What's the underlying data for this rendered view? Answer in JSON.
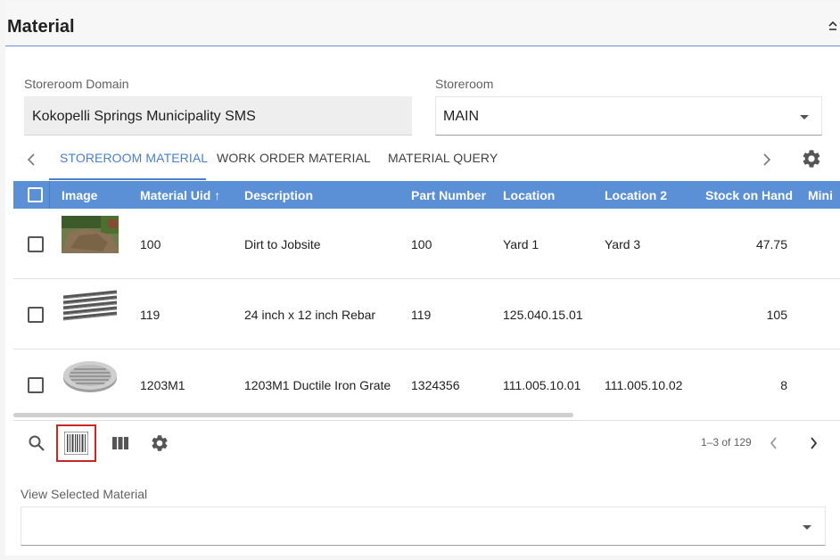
{
  "panel": {
    "title": "Material"
  },
  "form": {
    "domain_label": "Storeroom Domain",
    "domain_value": "Kokopelli Springs Municipality SMS",
    "storeroom_label": "Storeroom",
    "storeroom_value": "MAIN"
  },
  "tabs": {
    "items": [
      {
        "label": "STOREROOM MATERIAL",
        "active": true
      },
      {
        "label": "WORK ORDER MATERIAL",
        "active": false
      },
      {
        "label": "MATERIAL QUERY",
        "active": false
      }
    ]
  },
  "table": {
    "columns": {
      "image": "Image",
      "material_uid": "Material Uid",
      "description": "Description",
      "part_number": "Part Number",
      "location": "Location",
      "location2": "Location 2",
      "stock": "Stock on Hand",
      "min": "Mini"
    },
    "sort_indicator": "↑",
    "rows": [
      {
        "uid": "100",
        "description": "Dirt to Jobsite",
        "part_number": "100",
        "location": "Yard 1",
        "location2": "Yard 3",
        "stock": "47.75",
        "image": "dirt-photo"
      },
      {
        "uid": "119",
        "description": "24 inch x 12 inch Rebar",
        "part_number": "119",
        "location": "125.040.15.01",
        "location2": "",
        "stock": "105",
        "image": "rebar-photo"
      },
      {
        "uid": "1203M1",
        "description": "1203M1 Ductile Iron Grate",
        "part_number": "1324356",
        "location": "111.005.10.01",
        "location2": "111.005.10.02",
        "stock": "8",
        "image": "grate-photo"
      }
    ]
  },
  "toolbar": {
    "icons": [
      "search-icon",
      "barcode-icon",
      "columns-icon",
      "gear-icon"
    ],
    "pager_text": "1–3 of 129"
  },
  "selected": {
    "label": "View Selected Material",
    "value": ""
  },
  "colors": {
    "accent": "#5b8fd6",
    "tab_active": "#4a7fc9",
    "highlight": "#c62828"
  }
}
